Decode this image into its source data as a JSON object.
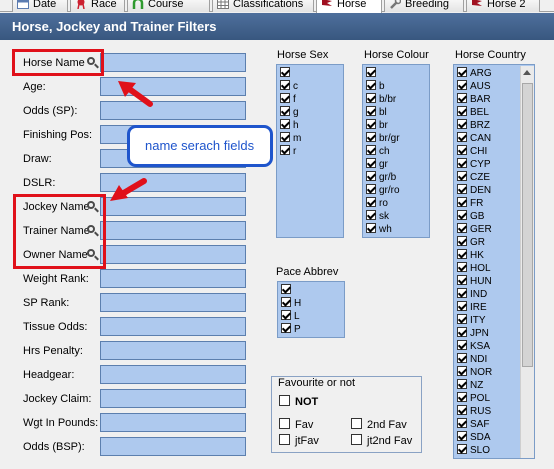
{
  "tabs": [
    {
      "label": "Date",
      "icon": "calendar-icon"
    },
    {
      "label": "Race",
      "icon": "rosette-icon"
    },
    {
      "label": "Course",
      "icon": "horseshoe-icon"
    },
    {
      "label": "Classifications",
      "icon": "grid-icon"
    },
    {
      "label": "Horse",
      "icon": "horse-flag-icon",
      "active": true
    },
    {
      "label": "Breeding",
      "icon": "wrench-icon"
    },
    {
      "label": "Horse 2",
      "icon": "horse-flag-icon"
    }
  ],
  "title": "Horse, Jockey and Trainer Filters",
  "fields": [
    {
      "label": "Horse Name",
      "search": true
    },
    {
      "label": "Age:",
      "search": false
    },
    {
      "label": "Odds (SP):",
      "search": false
    },
    {
      "label": "Finishing Pos:",
      "search": false
    },
    {
      "label": "Draw:",
      "search": false
    },
    {
      "label": "DSLR:",
      "search": false
    },
    {
      "label": "Jockey Name",
      "search": true
    },
    {
      "label": "Trainer Name",
      "search": true
    },
    {
      "label": "Owner Name",
      "search": true
    },
    {
      "label": "Weight Rank:",
      "search": false
    },
    {
      "label": "SP Rank:",
      "search": false
    },
    {
      "label": "Tissue Odds:",
      "search": false
    },
    {
      "label": "Hrs Penalty:",
      "search": false
    },
    {
      "label": "Headgear:",
      "search": false
    },
    {
      "label": "Jockey Claim:",
      "search": false
    },
    {
      "label": "Wgt In Pounds:",
      "search": false
    },
    {
      "label": "Odds (BSP):",
      "search": false
    }
  ],
  "horse_sex": {
    "title": "Horse Sex",
    "items": [
      "c",
      "f",
      "g",
      "h",
      "m",
      "r"
    ]
  },
  "horse_colour": {
    "title": "Horse Colour",
    "items": [
      "b",
      "b/br",
      "bl",
      "br",
      "br/gr",
      "ch",
      "gr",
      "gr/b",
      "gr/ro",
      "ro",
      "sk",
      "wh"
    ]
  },
  "horse_country": {
    "title": "Horse Country",
    "items": [
      "ARG",
      "AUS",
      "BAR",
      "BEL",
      "BRZ",
      "CAN",
      "CHI",
      "CYP",
      "CZE",
      "DEN",
      "FR",
      "GB",
      "GER",
      "GR",
      "HK",
      "HOL",
      "HUN",
      "IND",
      "IRE",
      "ITY",
      "JPN",
      "KSA",
      "NDI",
      "NOR",
      "NZ",
      "POL",
      "RUS",
      "SAF",
      "SDA",
      "SLO"
    ]
  },
  "pace": {
    "title": "Pace Abbrev",
    "items": [
      "H",
      "L",
      "P"
    ]
  },
  "favourite": {
    "title": "Favourite or not",
    "not_label": "NOT",
    "fav_label": "Fav",
    "jtfav_label": "jtFav",
    "second_fav_label": "2nd Fav",
    "jt2nd_fav_label": "jt2nd Fav"
  },
  "annotation": {
    "text": "name serach fields",
    "border_color": "#1f55cc",
    "highlight_color": "#e0101a"
  },
  "colors": {
    "input_fill": "#aec9ee",
    "title_bar": "#4e6f9c"
  }
}
